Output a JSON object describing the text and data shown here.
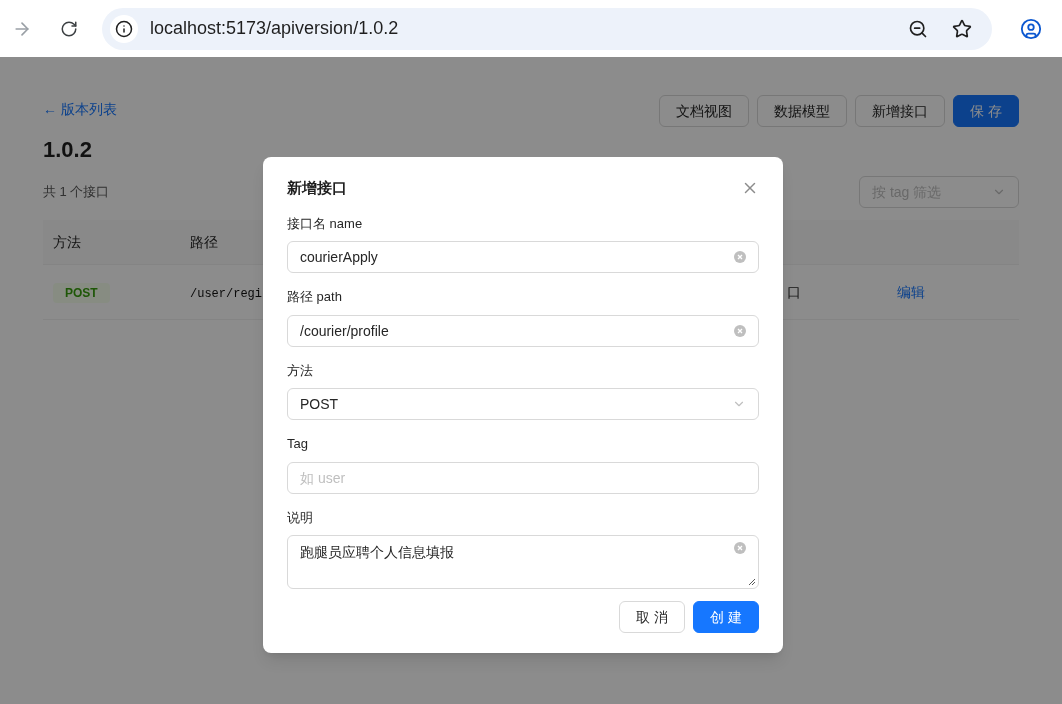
{
  "browser": {
    "url": "localhost:5173/apiversion/1.0.2"
  },
  "page": {
    "back_link": "← 版本列表",
    "title": "1.0.2",
    "count": "共 1 个接口",
    "actions": [
      {
        "label": "文档视图",
        "kind": "default"
      },
      {
        "label": "数据模型",
        "kind": "default"
      },
      {
        "label": "新增接口",
        "kind": "default"
      },
      {
        "label": "保 存",
        "kind": "primary"
      }
    ],
    "filter": {
      "placeholder": "按 tag 筛选"
    },
    "table": {
      "columns": [
        "方法",
        "路径"
      ],
      "rows": [
        {
          "method": "POST",
          "path": "/user/regi",
          "column_3": "口",
          "action": "编辑"
        }
      ]
    }
  },
  "dialog": {
    "title": "新增接口",
    "fields": [
      {
        "label": "接口名 name",
        "kind": "input",
        "value": "courierApply"
      },
      {
        "label": "路径 path",
        "kind": "input",
        "value": "/courier/profile"
      },
      {
        "label": "方法",
        "kind": "select",
        "value": "POST"
      },
      {
        "label": "Tag",
        "kind": "input",
        "placeholder": "如 user"
      },
      {
        "label": "说明",
        "kind": "textarea",
        "value": "跑腿员应聘个人信息填报"
      }
    ],
    "buttons": [
      {
        "label": "取 消",
        "kind": "default"
      },
      {
        "label": "创 建",
        "kind": "primary"
      }
    ]
  }
}
